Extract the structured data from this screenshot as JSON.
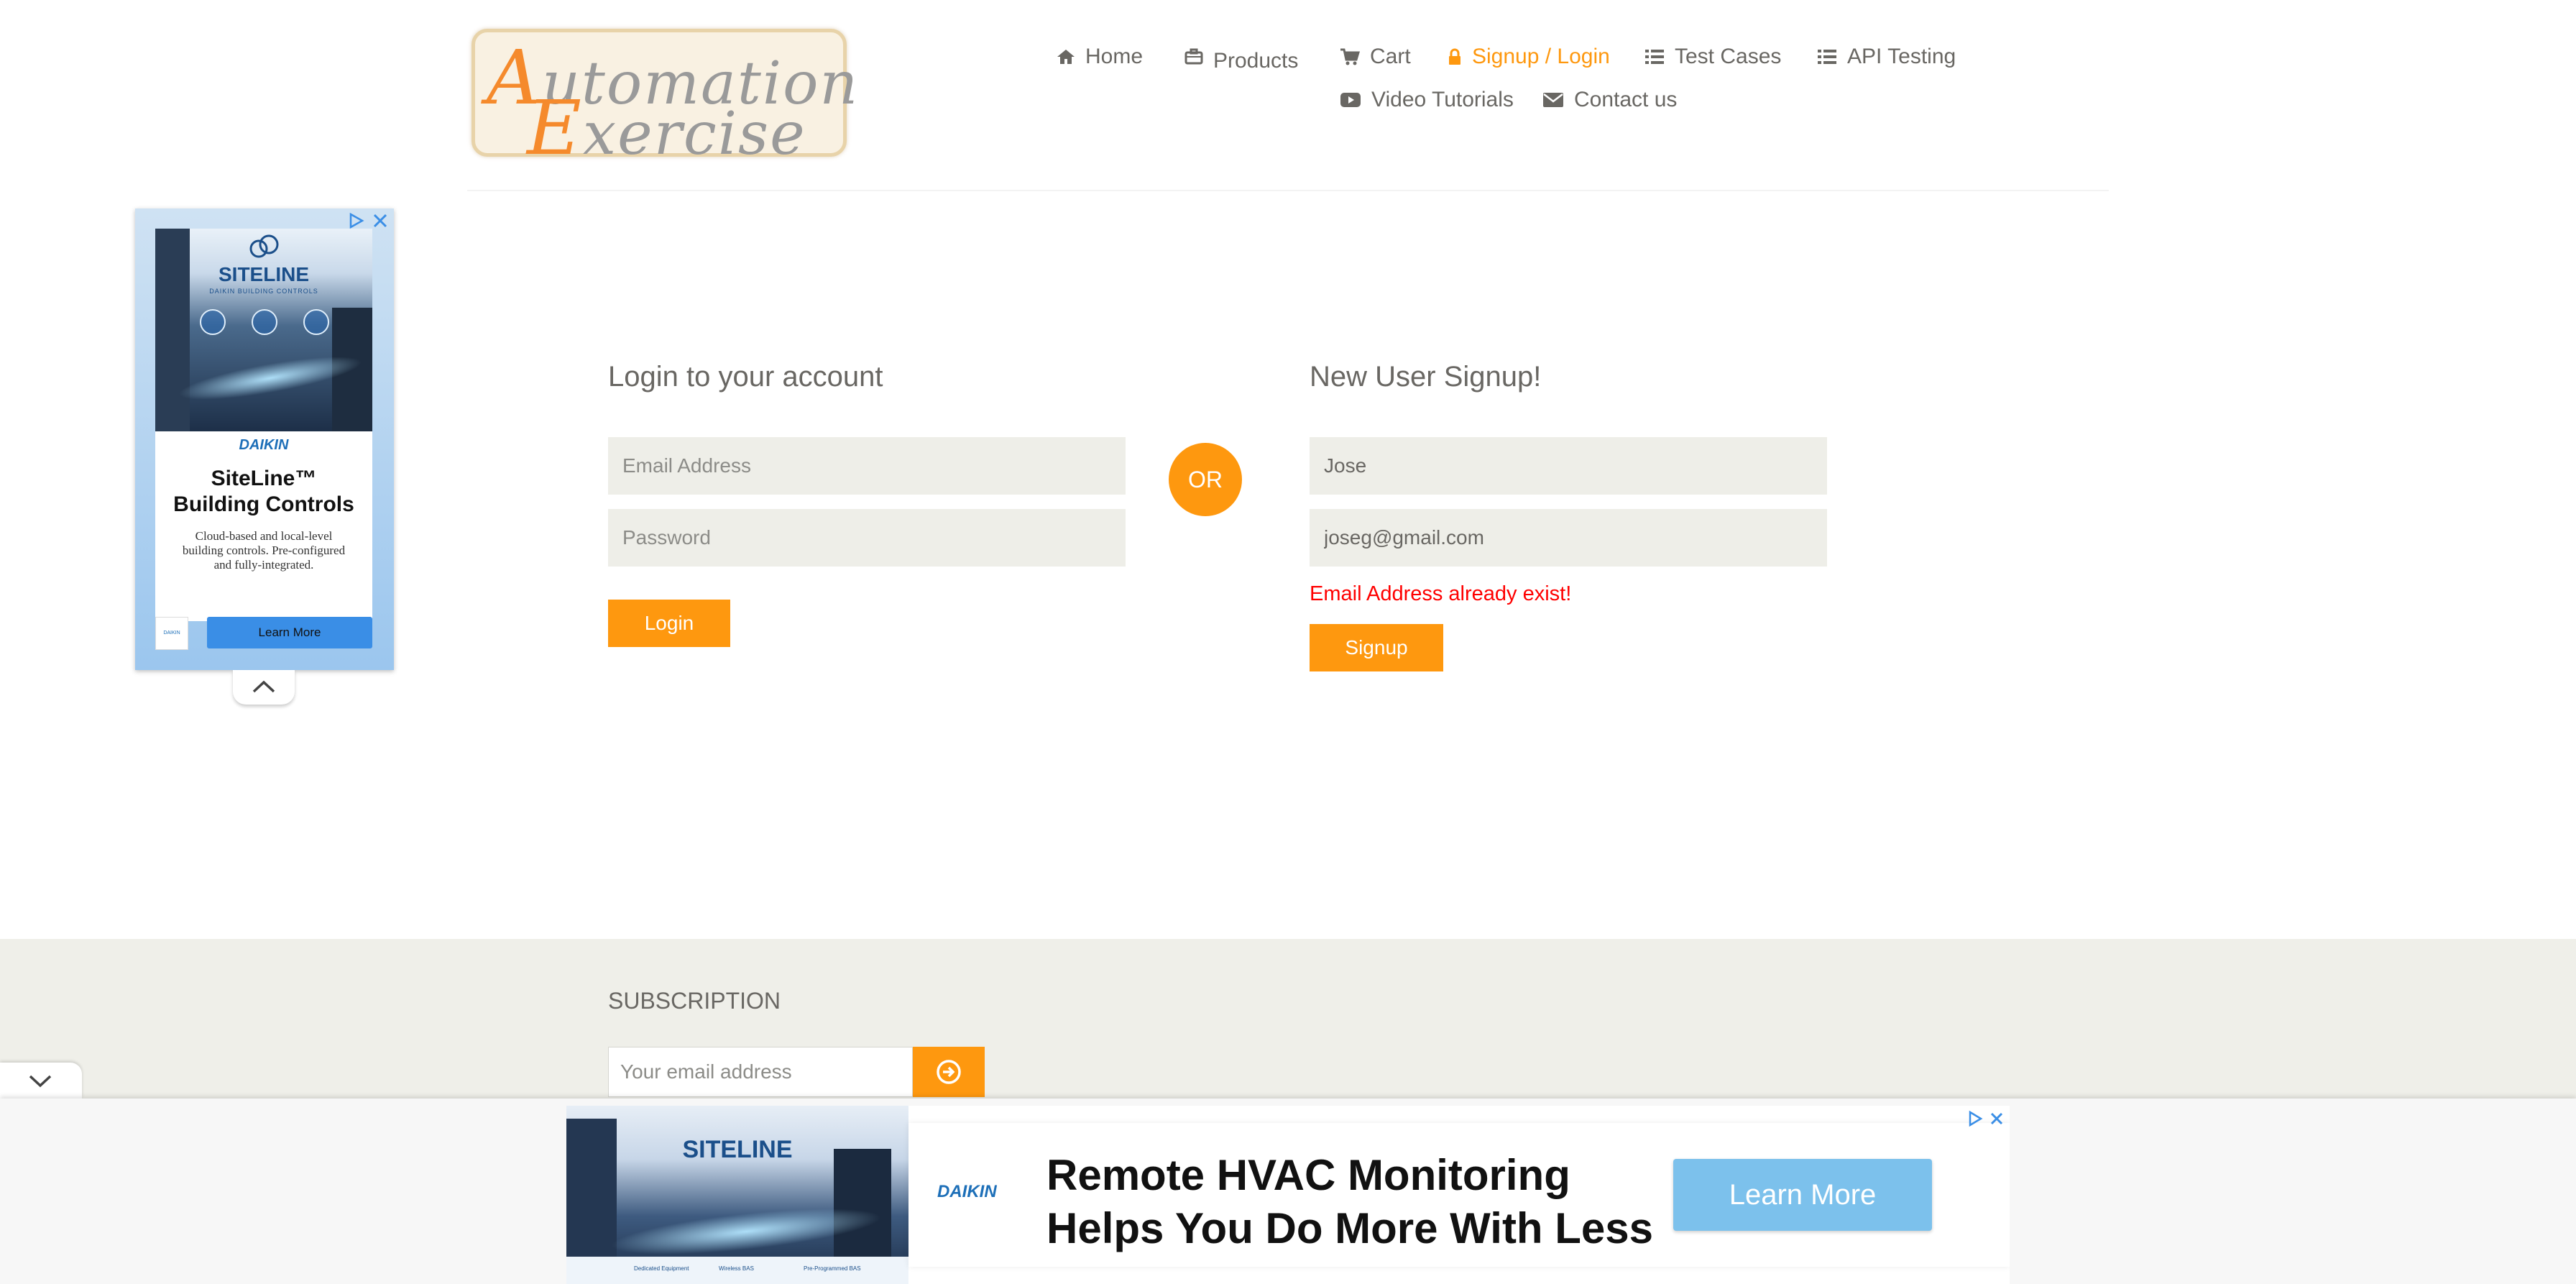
{
  "header": {
    "logo_text": "Automation Exercise",
    "nav": [
      {
        "label": "Home",
        "icon": "home-icon",
        "active": false
      },
      {
        "label": "Products",
        "icon": "briefcase-icon",
        "active": false
      },
      {
        "label": "Cart",
        "icon": "cart-icon",
        "active": false
      },
      {
        "label": "Signup / Login",
        "icon": "lock-icon",
        "active": true
      },
      {
        "label": "Test Cases",
        "icon": "list-icon",
        "active": false
      },
      {
        "label": "API Testing",
        "icon": "list-icon",
        "active": false
      },
      {
        "label": "Video Tutorials",
        "icon": "youtube-icon",
        "active": false
      },
      {
        "label": "Contact us",
        "icon": "envelope-icon",
        "active": false
      }
    ]
  },
  "login": {
    "title": "Login to your account",
    "email_placeholder": "Email Address",
    "password_placeholder": "Password",
    "button": "Login"
  },
  "or_label": "OR",
  "signup": {
    "title": "New User Signup!",
    "name_value": "Jose",
    "email_value": "joseg@gmail.com",
    "error": "Email Address already exist!",
    "button": "Signup"
  },
  "footer": {
    "subscription_title": "SUBSCRIPTION",
    "email_placeholder": "Your email address"
  },
  "ad_left": {
    "brand": "SITELINE",
    "brand_sub": "DAIKIN BUILDING CONTROLS",
    "company": "DAIKIN",
    "headline_1": "SiteLine™",
    "headline_2": "Building Controls",
    "body": "Cloud-based and local-level building controls. Pre-configured and fully-integrated.",
    "cta": "Learn More"
  },
  "ad_bottom": {
    "brand": "SITELINE",
    "company": "DAIKIN",
    "headline_1": "Remote HVAC Monitoring",
    "headline_2": "Helps You Do More With Less",
    "features": [
      "Dedicated Equipment",
      "Wireless BAS",
      "Pre-Programmed BAS"
    ],
    "cta": "Learn More"
  },
  "colors": {
    "accent": "#fe980f",
    "text": "#696763",
    "field_bg": "#eeeee8",
    "footer_bg": "#efefe9",
    "error": "#ff0000"
  }
}
